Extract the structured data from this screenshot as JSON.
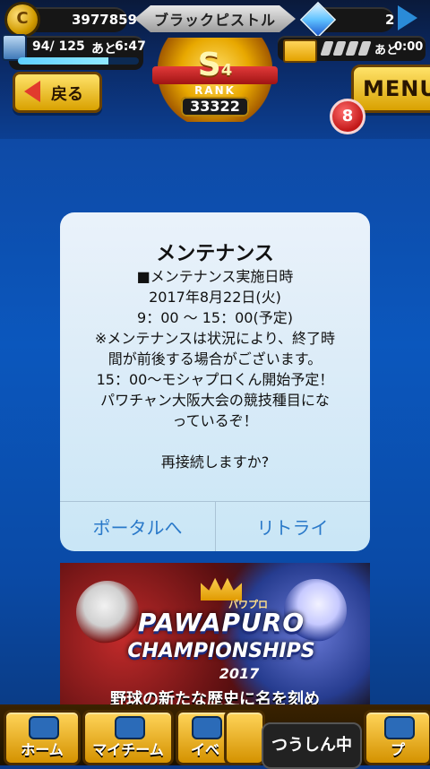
{
  "header": {
    "coins": "3977859",
    "player_title": "ブラックピストル",
    "gems": "2",
    "stamina_text": "94/ 125",
    "stamina_fraction": 0.75,
    "stamina_timer_prefix": "あと",
    "stamina_timer": "6:47",
    "battery_timer_prefix": "あと",
    "battery_timer": "0:00",
    "rank_letter": "S",
    "rank_sub": "4",
    "rank_label": "RANK",
    "rank_score": "33322"
  },
  "nav": {
    "back_label": "戻る",
    "menu_label": "MENU",
    "notification_count": "8"
  },
  "dialog": {
    "title": "メンテナンス",
    "lines": [
      "■メンテナンス実施日時",
      "2017年8月22日(火)",
      "9：00 〜 15：00(予定)",
      "※メンテナンスは状況により、終了時",
      "間が前後する場合がございます。",
      "15：00〜モシャプロくん開始予定！",
      "パワチャン大阪大会の競技種目にな",
      "っているぞ！",
      "",
      "再接続しますか?"
    ],
    "button_left": "ポータルへ",
    "button_right": "リトライ"
  },
  "banner": {
    "small_tag": "パワプロ",
    "title_line1": "PAWAPURO",
    "title_line2": "CHAMPIONSHIPS",
    "year": "2017",
    "tagline": "野球の新たな歴史に名を刻め"
  },
  "bottom_nav": {
    "items": [
      "ホーム",
      "マイチーム",
      "イベ",
      "つうしん中",
      "プ"
    ]
  },
  "colors": {
    "accent_gold": "#e3a200",
    "dialog_button_text": "#2a79c9",
    "notification_red": "#c21818"
  }
}
